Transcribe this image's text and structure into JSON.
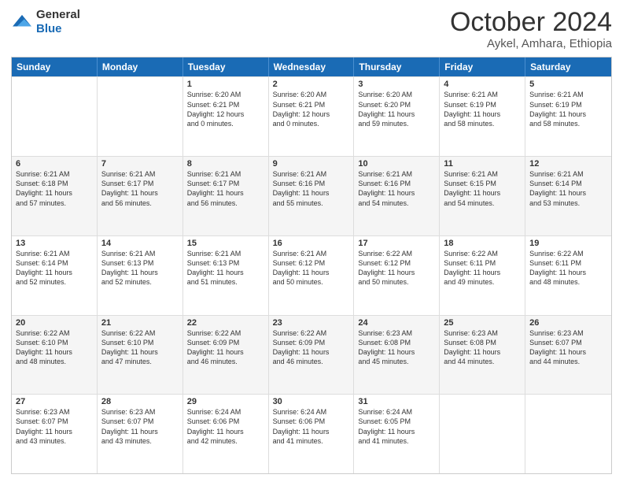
{
  "logo": {
    "general": "General",
    "blue": "Blue"
  },
  "title": "October 2024",
  "subtitle": "Aykel, Amhara, Ethiopia",
  "days": [
    "Sunday",
    "Monday",
    "Tuesday",
    "Wednesday",
    "Thursday",
    "Friday",
    "Saturday"
  ],
  "weeks": [
    [
      {
        "day": "",
        "text": ""
      },
      {
        "day": "",
        "text": ""
      },
      {
        "day": "1",
        "text": "Sunrise: 6:20 AM\nSunset: 6:21 PM\nDaylight: 12 hours\nand 0 minutes."
      },
      {
        "day": "2",
        "text": "Sunrise: 6:20 AM\nSunset: 6:21 PM\nDaylight: 12 hours\nand 0 minutes."
      },
      {
        "day": "3",
        "text": "Sunrise: 6:20 AM\nSunset: 6:20 PM\nDaylight: 11 hours\nand 59 minutes."
      },
      {
        "day": "4",
        "text": "Sunrise: 6:21 AM\nSunset: 6:19 PM\nDaylight: 11 hours\nand 58 minutes."
      },
      {
        "day": "5",
        "text": "Sunrise: 6:21 AM\nSunset: 6:19 PM\nDaylight: 11 hours\nand 58 minutes."
      }
    ],
    [
      {
        "day": "6",
        "text": "Sunrise: 6:21 AM\nSunset: 6:18 PM\nDaylight: 11 hours\nand 57 minutes."
      },
      {
        "day": "7",
        "text": "Sunrise: 6:21 AM\nSunset: 6:17 PM\nDaylight: 11 hours\nand 56 minutes."
      },
      {
        "day": "8",
        "text": "Sunrise: 6:21 AM\nSunset: 6:17 PM\nDaylight: 11 hours\nand 56 minutes."
      },
      {
        "day": "9",
        "text": "Sunrise: 6:21 AM\nSunset: 6:16 PM\nDaylight: 11 hours\nand 55 minutes."
      },
      {
        "day": "10",
        "text": "Sunrise: 6:21 AM\nSunset: 6:16 PM\nDaylight: 11 hours\nand 54 minutes."
      },
      {
        "day": "11",
        "text": "Sunrise: 6:21 AM\nSunset: 6:15 PM\nDaylight: 11 hours\nand 54 minutes."
      },
      {
        "day": "12",
        "text": "Sunrise: 6:21 AM\nSunset: 6:14 PM\nDaylight: 11 hours\nand 53 minutes."
      }
    ],
    [
      {
        "day": "13",
        "text": "Sunrise: 6:21 AM\nSunset: 6:14 PM\nDaylight: 11 hours\nand 52 minutes."
      },
      {
        "day": "14",
        "text": "Sunrise: 6:21 AM\nSunset: 6:13 PM\nDaylight: 11 hours\nand 52 minutes."
      },
      {
        "day": "15",
        "text": "Sunrise: 6:21 AM\nSunset: 6:13 PM\nDaylight: 11 hours\nand 51 minutes."
      },
      {
        "day": "16",
        "text": "Sunrise: 6:21 AM\nSunset: 6:12 PM\nDaylight: 11 hours\nand 50 minutes."
      },
      {
        "day": "17",
        "text": "Sunrise: 6:22 AM\nSunset: 6:12 PM\nDaylight: 11 hours\nand 50 minutes."
      },
      {
        "day": "18",
        "text": "Sunrise: 6:22 AM\nSunset: 6:11 PM\nDaylight: 11 hours\nand 49 minutes."
      },
      {
        "day": "19",
        "text": "Sunrise: 6:22 AM\nSunset: 6:11 PM\nDaylight: 11 hours\nand 48 minutes."
      }
    ],
    [
      {
        "day": "20",
        "text": "Sunrise: 6:22 AM\nSunset: 6:10 PM\nDaylight: 11 hours\nand 48 minutes."
      },
      {
        "day": "21",
        "text": "Sunrise: 6:22 AM\nSunset: 6:10 PM\nDaylight: 11 hours\nand 47 minutes."
      },
      {
        "day": "22",
        "text": "Sunrise: 6:22 AM\nSunset: 6:09 PM\nDaylight: 11 hours\nand 46 minutes."
      },
      {
        "day": "23",
        "text": "Sunrise: 6:22 AM\nSunset: 6:09 PM\nDaylight: 11 hours\nand 46 minutes."
      },
      {
        "day": "24",
        "text": "Sunrise: 6:23 AM\nSunset: 6:08 PM\nDaylight: 11 hours\nand 45 minutes."
      },
      {
        "day": "25",
        "text": "Sunrise: 6:23 AM\nSunset: 6:08 PM\nDaylight: 11 hours\nand 44 minutes."
      },
      {
        "day": "26",
        "text": "Sunrise: 6:23 AM\nSunset: 6:07 PM\nDaylight: 11 hours\nand 44 minutes."
      }
    ],
    [
      {
        "day": "27",
        "text": "Sunrise: 6:23 AM\nSunset: 6:07 PM\nDaylight: 11 hours\nand 43 minutes."
      },
      {
        "day": "28",
        "text": "Sunrise: 6:23 AM\nSunset: 6:07 PM\nDaylight: 11 hours\nand 43 minutes."
      },
      {
        "day": "29",
        "text": "Sunrise: 6:24 AM\nSunset: 6:06 PM\nDaylight: 11 hours\nand 42 minutes."
      },
      {
        "day": "30",
        "text": "Sunrise: 6:24 AM\nSunset: 6:06 PM\nDaylight: 11 hours\nand 41 minutes."
      },
      {
        "day": "31",
        "text": "Sunrise: 6:24 AM\nSunset: 6:05 PM\nDaylight: 11 hours\nand 41 minutes."
      },
      {
        "day": "",
        "text": ""
      },
      {
        "day": "",
        "text": ""
      }
    ]
  ]
}
